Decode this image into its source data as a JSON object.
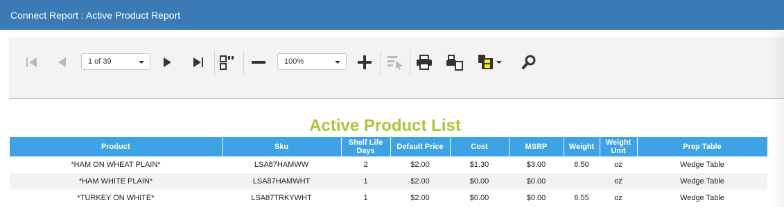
{
  "window": {
    "title": "Connect Report : Active Product Report"
  },
  "toolbar": {
    "page_select": "1 of 39",
    "zoom_select": "100%"
  },
  "report": {
    "title": "Active Product List",
    "columns": [
      "Product",
      "Sku",
      "Shelf Life Days",
      "Default Price",
      "Cost",
      "MSRP",
      "Weight",
      "Weight Unit",
      "Prep Table"
    ],
    "rows": [
      [
        "*HAM ON WHEAT PLAIN*",
        "LSA87HAMWW",
        "2",
        "$2.00",
        "$1.30",
        "$3.00",
        "6.50",
        "oz",
        "Wedge Table"
      ],
      [
        "*HAM WHITE PLAIN*",
        "LSA87HAMWHT",
        "1",
        "$2.00",
        "$0.00",
        "$0.00",
        "",
        "oz",
        "Wedge Table"
      ],
      [
        "*TURKEY ON WHITE*",
        "LSA87TRKYWHT",
        "1",
        "$2.00",
        "$0.00",
        "$0.00",
        "6.55",
        "oz",
        "Wedge Table"
      ]
    ]
  },
  "colors": {
    "titlebar": "#3a7ab5",
    "header": "#3ea3e6",
    "report_title": "#a7c93a",
    "highlight": "#f4f400"
  }
}
